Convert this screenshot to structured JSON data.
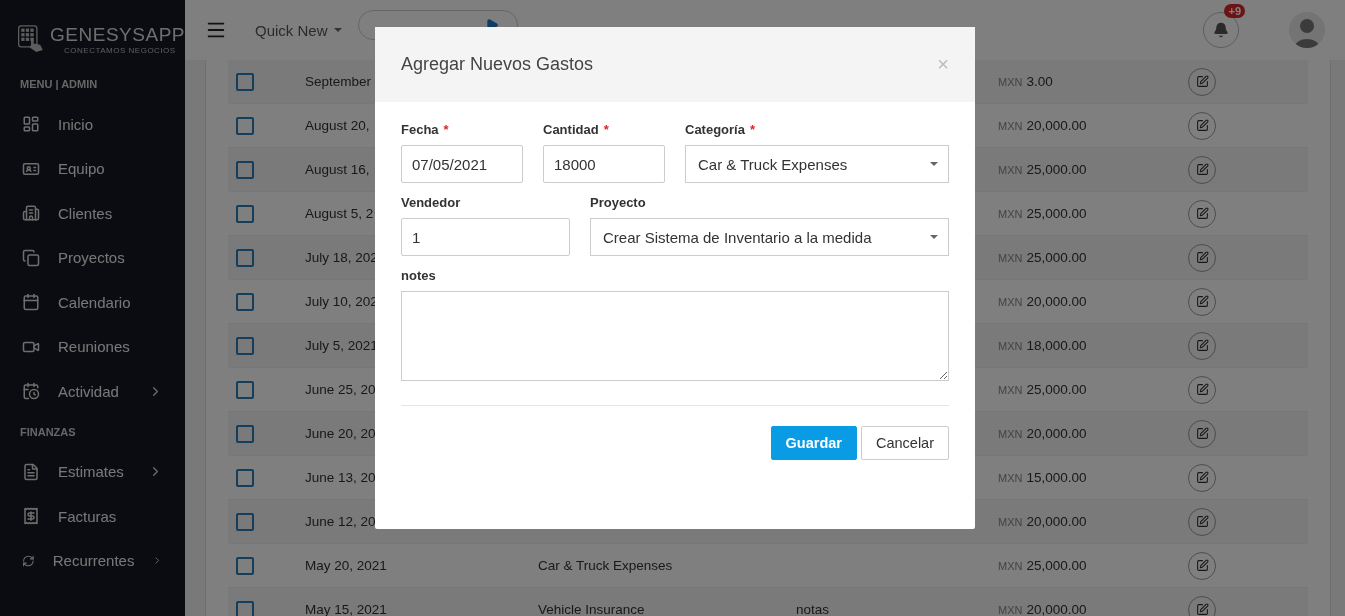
{
  "brand": {
    "name": "GENESYS**APP**",
    "tagline": "CONECTAMOS NEGOCIOS"
  },
  "sidebar": {
    "sections": [
      {
        "title": "MENU | ADMIN",
        "items": [
          {
            "label": "Inicio",
            "has_submenu": false
          },
          {
            "label": "Equipo",
            "has_submenu": false
          },
          {
            "label": "Clientes",
            "has_submenu": false
          },
          {
            "label": "Proyectos",
            "has_submenu": false
          },
          {
            "label": "Calendario",
            "has_submenu": false
          },
          {
            "label": "Reuniones",
            "has_submenu": false
          },
          {
            "label": "Actividad",
            "has_submenu": true
          }
        ]
      },
      {
        "title": "FINANZAS",
        "items": [
          {
            "label": "Estimates",
            "has_submenu": true
          },
          {
            "label": "Facturas",
            "has_submenu": false
          },
          {
            "label": "Recurrentes",
            "has_submenu": true
          }
        ]
      }
    ]
  },
  "topbar": {
    "quick_new": "Quick New",
    "notifications": {
      "badge": "+9"
    }
  },
  "table": {
    "rows": [
      {
        "checked": false,
        "date": "September",
        "amount": "3.00",
        "currency": "MXN"
      },
      {
        "checked": false,
        "date": "August 20,",
        "amount": "20,000.00",
        "currency": "MXN"
      },
      {
        "checked": false,
        "date": "August 16,",
        "amount": "25,000.00",
        "currency": "MXN"
      },
      {
        "checked": false,
        "date": "August 5, 2",
        "amount": "25,000.00",
        "currency": "MXN"
      },
      {
        "checked": false,
        "date": "July 18, 202",
        "amount": "25,000.00",
        "currency": "MXN"
      },
      {
        "checked": false,
        "date": "July 10, 202",
        "amount": "20,000.00",
        "currency": "MXN"
      },
      {
        "checked": false,
        "date": "July 5, 2021",
        "amount": "18,000.00",
        "currency": "MXN"
      },
      {
        "checked": false,
        "date": "June 25, 20",
        "amount": "25,000.00",
        "currency": "MXN"
      },
      {
        "checked": false,
        "date": "June 20, 20",
        "amount": "20,000.00",
        "currency": "MXN"
      },
      {
        "checked": false,
        "date": "June 13, 20",
        "amount": "15,000.00",
        "currency": "MXN"
      },
      {
        "checked": false,
        "date": "June 12, 20",
        "amount": "20,000.00",
        "currency": "MXN"
      },
      {
        "checked": false,
        "date": "May 20, 2021",
        "category": "Car & Truck Expenses",
        "amount": "25,000.00",
        "currency": "MXN"
      },
      {
        "checked": false,
        "date": "May 15, 2021",
        "category": "Vehicle Insurance",
        "notes": "notas",
        "amount": "20,000.00",
        "currency": "MXN"
      }
    ]
  },
  "modal": {
    "title": "Agregar Nuevos Gastos",
    "close": "×",
    "rows": [
      [
        {
          "label": "Fecha",
          "required_mark": "*",
          "kind": "input",
          "value": "07/05/2021"
        },
        {
          "label": "Cantidad",
          "required_mark": "*",
          "kind": "input",
          "value": "18000"
        },
        {
          "label": "Categoría",
          "required_mark": "*",
          "kind": "select",
          "value": "Car & Truck Expenses"
        }
      ],
      [
        {
          "label": "Vendedor",
          "kind": "input",
          "value": "1"
        },
        {
          "label": "Proyecto",
          "kind": "select",
          "value": "Crear Sistema de Inventario a la medida"
        }
      ],
      [
        {
          "label": "notes",
          "kind": "textarea"
        }
      ]
    ],
    "buttons": [
      {
        "label": "Guardar",
        "kind": "primary"
      },
      {
        "label": "Cancelar",
        "kind": "default"
      }
    ]
  }
}
